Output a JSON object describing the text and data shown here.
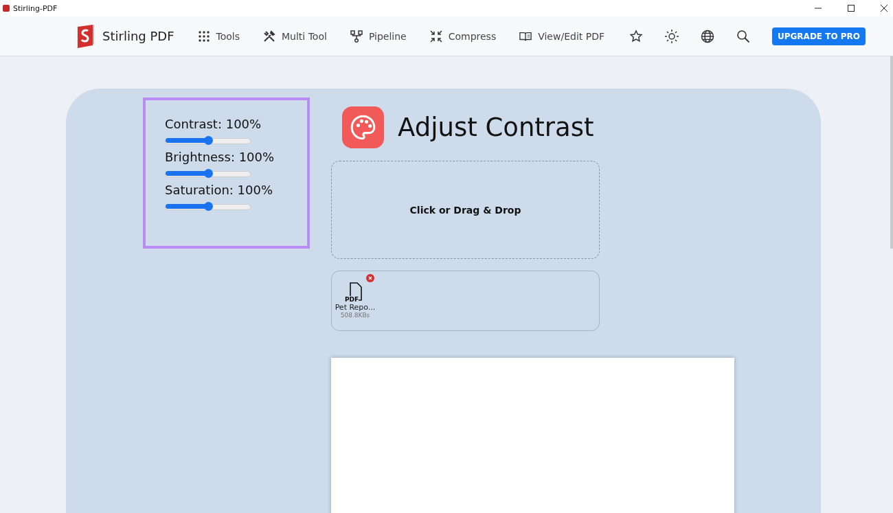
{
  "window": {
    "title": "Stirling-PDF"
  },
  "brand": "Stirling PDF",
  "nav": [
    {
      "label": "Tools"
    },
    {
      "label": "Multi Tool"
    },
    {
      "label": "Pipeline"
    },
    {
      "label": "Compress"
    },
    {
      "label": "View/Edit PDF"
    }
  ],
  "upgrade_button": "UPGRADE TO PRO",
  "adjustments": [
    {
      "label": "Contrast: 100%",
      "level": 0.5
    },
    {
      "label": "Brightness: 100%",
      "level": 0.5
    },
    {
      "label": "Saturation: 100%",
      "level": 0.5
    }
  ],
  "page_title": "Adjust Contrast",
  "drop_zone": "Click or Drag & Drop",
  "files": [
    {
      "badge": "PDF",
      "name": "Pet Repo...",
      "size": "508.8KBs"
    }
  ]
}
